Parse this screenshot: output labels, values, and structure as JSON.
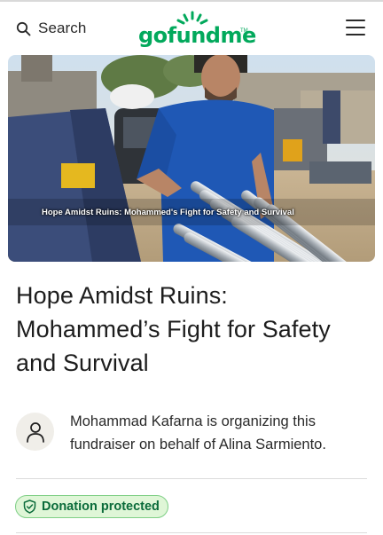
{
  "header": {
    "search_label": "Search",
    "logo_text": "gofundme",
    "logo_tm": "TM",
    "brand_color": "#02a95c",
    "icons": {
      "search": "search-icon",
      "menu": "hamburger-menu-icon",
      "logo": "sprout-logo-icon"
    }
  },
  "hero": {
    "caption": "Hope Amidst Ruins: Mohammed's Fight for Safety and Survival"
  },
  "campaign": {
    "title": "Hope Amidst Ruins: Mohammed’s Fight for Safety and Survival"
  },
  "organizer": {
    "text": "Mohammad Kafarna is organizing this fundraiser on behalf of Alina Sarmiento.",
    "avatar_icon": "user-icon"
  },
  "badge": {
    "label": "Donation protected",
    "icon": "shield-check-icon",
    "colors": {
      "background": "#dff6d7",
      "border": "#7fcf86",
      "text": "#0a6b3a"
    }
  }
}
